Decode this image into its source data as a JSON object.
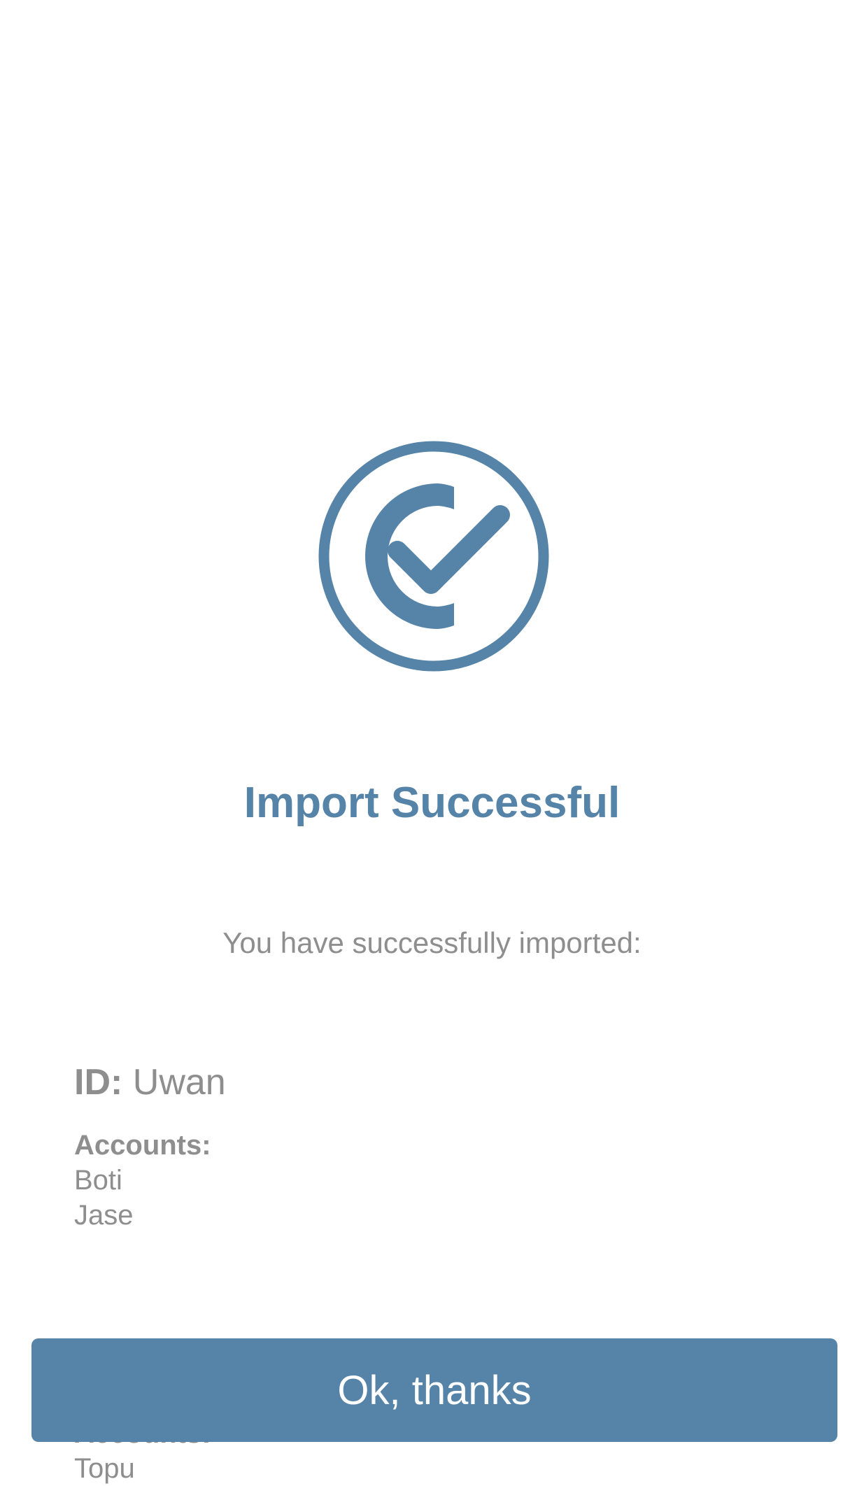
{
  "theme": {
    "accent": "#5684a8",
    "text_muted": "#8e8e8e",
    "background": "#ffffff"
  },
  "status_icon": "check-circle-icon",
  "title": "Import Successful",
  "subtitle": "You have successfully imported:",
  "details": {
    "id_label": "ID:",
    "id_value": "Uwan",
    "sections": [
      {
        "label": "Accounts:",
        "items": [
          "Boti",
          "Jase"
        ]
      },
      {
        "label": "Accounts:",
        "items": [
          "Topu"
        ]
      }
    ]
  },
  "ok_button_label": "Ok, thanks"
}
